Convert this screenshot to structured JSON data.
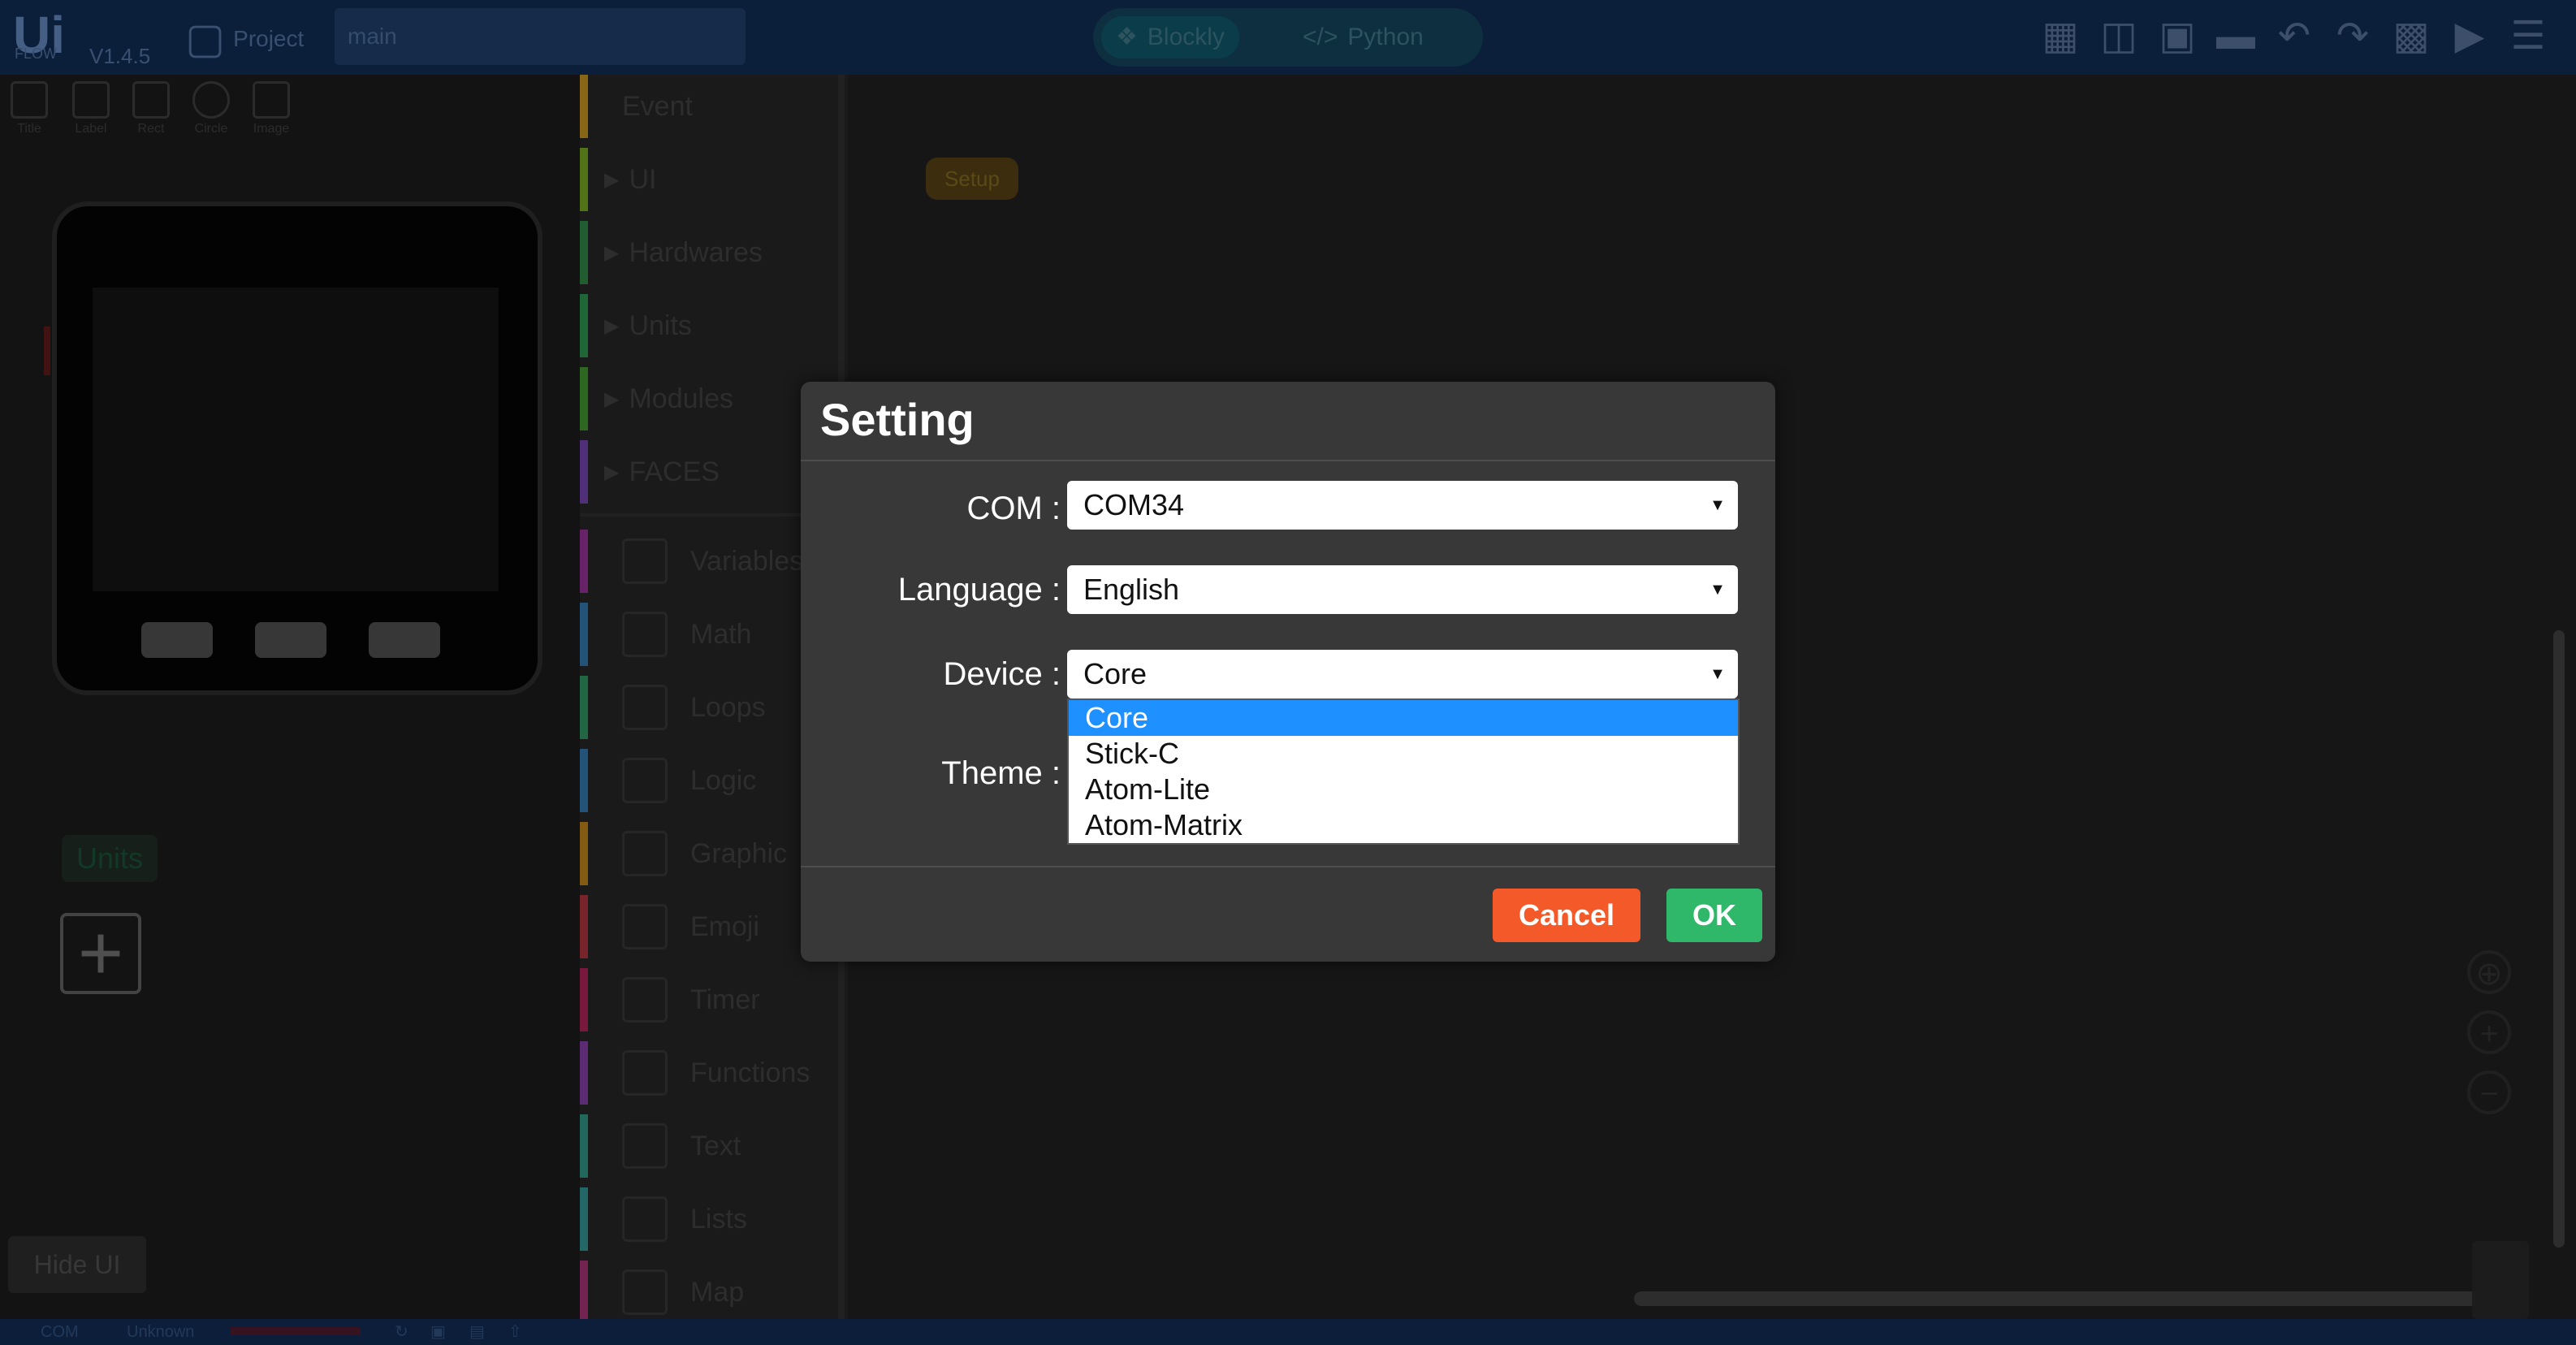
{
  "app": {
    "logo": "Ui",
    "sublogo": "FLOW",
    "version": "V1.4.5",
    "project_label": "Project",
    "project_name": "main"
  },
  "modes": [
    {
      "label": "Blockly"
    },
    {
      "label": "Python"
    }
  ],
  "left_tools": [
    {
      "label": "Title"
    },
    {
      "label": "Label"
    },
    {
      "label": "Rect"
    },
    {
      "label": "Circle"
    },
    {
      "label": "Image"
    }
  ],
  "units_label": "Units",
  "hide_ui_label": "Hide UI",
  "palette": {
    "categories": [
      {
        "label": "Event",
        "color": "#b58a1e",
        "expandable": false
      },
      {
        "label": "UI",
        "color": "#6c9b22",
        "expandable": true
      },
      {
        "label": "Hardwares",
        "color": "#2c7d42",
        "expandable": true
      },
      {
        "label": "Units",
        "color": "#2a8a4a",
        "expandable": true
      },
      {
        "label": "Modules",
        "color": "#3e8a2c",
        "expandable": true
      },
      {
        "label": "FACES",
        "color": "#6a3fa0",
        "expandable": true
      }
    ],
    "blocks": [
      {
        "label": "Variables",
        "color": "#8b2f8b"
      },
      {
        "label": "Math",
        "color": "#2f6fa0"
      },
      {
        "label": "Loops",
        "color": "#2e8a5a"
      },
      {
        "label": "Logic",
        "color": "#2f6fa0"
      },
      {
        "label": "Graphic",
        "color": "#b07a1a"
      },
      {
        "label": "Emoji",
        "color": "#a0303a"
      },
      {
        "label": "Timer",
        "color": "#a02050"
      },
      {
        "label": "Functions",
        "color": "#7a3a9a"
      },
      {
        "label": "Text",
        "color": "#2e8a7a"
      },
      {
        "label": "Lists",
        "color": "#2f8a8a"
      },
      {
        "label": "Map",
        "color": "#9a2f6a"
      }
    ]
  },
  "workspace": {
    "setup_block": "Setup"
  },
  "status": {
    "com": "COM",
    "connection": "Unknown"
  },
  "dialog": {
    "title": "Setting",
    "com_label": "COM :",
    "com_value": "COM34",
    "language_label": "Language :",
    "language_value": "English",
    "device_label": "Device :",
    "device_value": "Core",
    "theme_label": "Theme :",
    "device_options": [
      "Core",
      "Stick-C",
      "Atom-Lite",
      "Atom-Matrix"
    ],
    "selected_device_index": 0,
    "cancel_label": "Cancel",
    "ok_label": "OK",
    "cancel_color": "#f4592a",
    "ok_color": "#2fb86a"
  }
}
